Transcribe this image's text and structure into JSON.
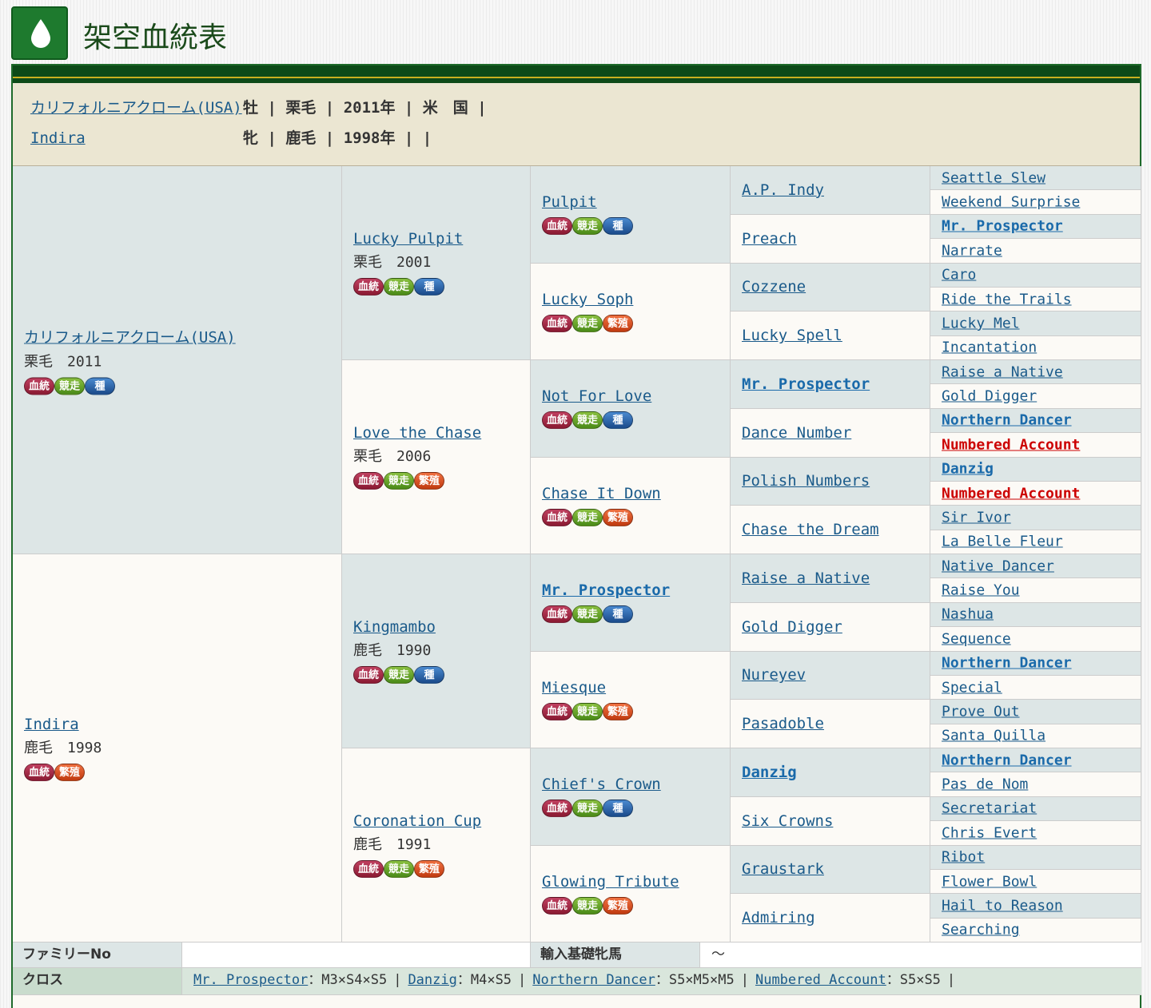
{
  "page": {
    "title": "架空血統表"
  },
  "subject": {
    "horse": {
      "name": "カリフォルニアクローム(USA)",
      "sex": "牡",
      "color": "栗毛",
      "year": "2011年",
      "country": "米　国"
    },
    "dam": {
      "name": "Indira",
      "sex": "牝",
      "color": "鹿毛",
      "year": "1998年",
      "country": ""
    }
  },
  "badges": {
    "kettou": "血統",
    "race": "競走",
    "stud": "種",
    "breed": "繁殖"
  },
  "pedigree": {
    "g1": [
      {
        "name": "カリフォルニアクローム(USA)",
        "meta": "栗毛　2011"
      },
      {
        "name": "Indira",
        "meta": "鹿毛　1998"
      }
    ],
    "g2": [
      {
        "name": "Lucky Pulpit",
        "meta": "栗毛　2001"
      },
      {
        "name": "Love the Chase",
        "meta": "栗毛　2006"
      },
      {
        "name": "Kingmambo",
        "meta": "鹿毛　1990"
      },
      {
        "name": "Coronation Cup",
        "meta": "鹿毛　1991"
      }
    ],
    "g3": [
      {
        "name": "Pulpit"
      },
      {
        "name": "Lucky Soph"
      },
      {
        "name": "Not For Love"
      },
      {
        "name": "Chase It Down"
      },
      {
        "name": "Mr. Prospector"
      },
      {
        "name": "Miesque"
      },
      {
        "name": "Chief's Crown"
      },
      {
        "name": "Glowing Tribute"
      }
    ],
    "g4": [
      "A.P. Indy",
      "Preach",
      "Cozzene",
      "Lucky Spell",
      "Mr. Prospector",
      "Dance Number",
      "Polish Numbers",
      "Chase the Dream",
      "Raise a Native",
      "Gold Digger",
      "Nureyev",
      "Pasadoble",
      "Danzig",
      "Six Crowns",
      "Graustark",
      "Admiring"
    ],
    "g5": [
      "Seattle Slew",
      "Weekend Surprise",
      "Mr. Prospector",
      "Narrate",
      "Caro",
      "Ride the Trails",
      "Lucky Mel",
      "Incantation",
      "Raise a Native",
      "Gold Digger",
      "Northern Dancer",
      "Numbered Account",
      "Danzig",
      "Numbered Account",
      "Sir Ivor",
      "La Belle Fleur",
      "Native Dancer",
      "Raise You",
      "Nashua",
      "Sequence",
      "Northern Dancer",
      "Special",
      "Prove Out",
      "Santa Quilla",
      "Northern Dancer",
      "Pas de Nom",
      "Secretariat",
      "Chris Evert",
      "Ribot",
      "Flower Bowl",
      "Hail to Reason",
      "Searching"
    ]
  },
  "footer": {
    "family_label": "ファミリーNo",
    "family_value": "",
    "import_label": "輸入基礎牝馬",
    "import_value": "～",
    "cross_label": "クロス",
    "cross": [
      {
        "name": "Mr. Prospector",
        "value": "：M3×S4×S5"
      },
      {
        "name": "Danzig",
        "value": "：M4×S5"
      },
      {
        "name": "Northern Dancer",
        "value": "：S5×M5×M5"
      },
      {
        "name": "Numbered Account",
        "value": "：S5×S5"
      }
    ],
    "separator": "|"
  },
  "colors": {
    "green": "#1e7a2e",
    "link": "#1a5a8a",
    "highlight_blue": "#1a6aaa",
    "highlight_red": "#cc0000"
  }
}
